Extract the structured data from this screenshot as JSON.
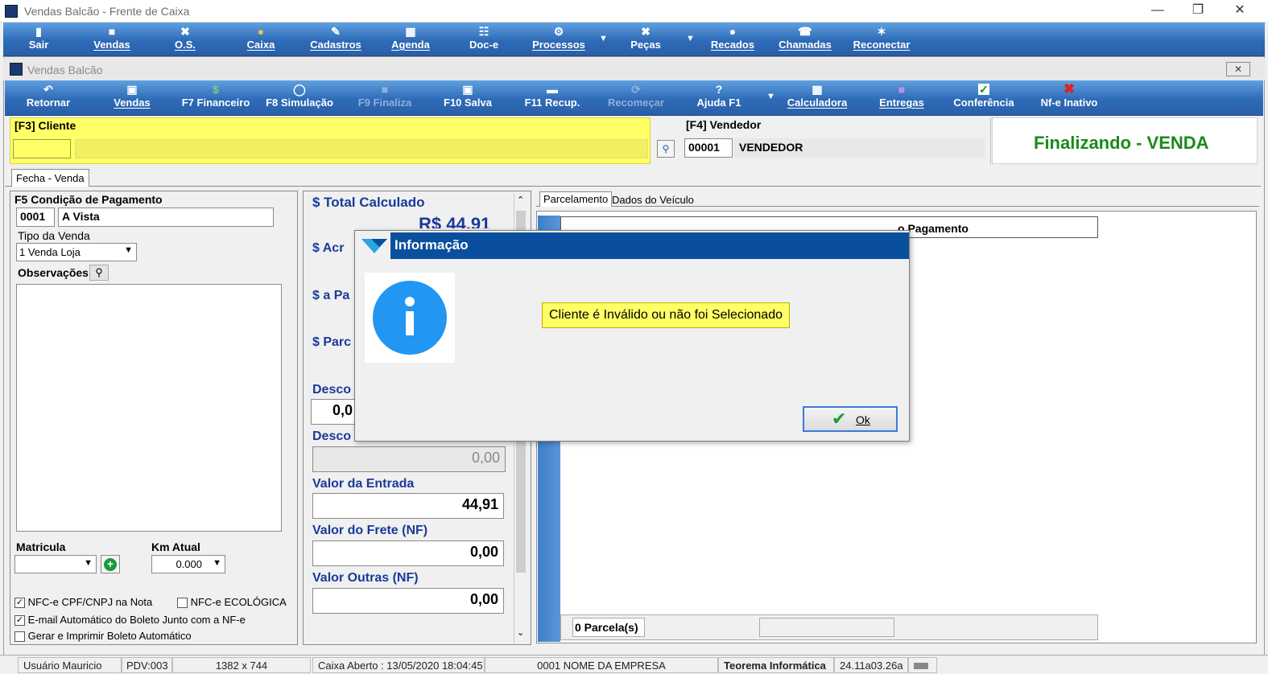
{
  "window": {
    "title": "Vendas Balcão - Frente de Caixa"
  },
  "main_toolbar": [
    {
      "label": "Sair",
      "icon": "exit-icon"
    },
    {
      "label": "Vendas",
      "icon": "sales-icon"
    },
    {
      "label": "O.S.",
      "icon": "tools-icon"
    },
    {
      "label": "Caixa",
      "icon": "cash-icon"
    },
    {
      "label": "Cadastros",
      "icon": "register-icon"
    },
    {
      "label": "Agenda",
      "icon": "calendar-icon"
    },
    {
      "label": "Doc-e",
      "icon": "document-icon"
    },
    {
      "label": "Processos",
      "icon": "gear-icon"
    },
    {
      "label": "Peças",
      "icon": "wrench-icon"
    },
    {
      "label": "Recados",
      "icon": "chat-icon"
    },
    {
      "label": "Chamadas",
      "icon": "support-icon"
    },
    {
      "label": "Reconectar",
      "icon": "reconnect-icon"
    }
  ],
  "inner_window": {
    "title": "Vendas Balcão"
  },
  "sub_toolbar": [
    {
      "label": "Retornar",
      "icon": "return-icon"
    },
    {
      "label": "Vendas",
      "icon": "sales-icon"
    },
    {
      "label": "F7 Financeiro",
      "icon": "money-icon"
    },
    {
      "label": "F8 Simulação",
      "icon": "simulation-icon"
    },
    {
      "label": "F9 Finaliza",
      "icon": "finish-icon"
    },
    {
      "label": "F10 Salva",
      "icon": "save-icon"
    },
    {
      "label": "F11 Recup.",
      "icon": "recover-icon"
    },
    {
      "label": "Recomeçar",
      "icon": "restart-icon"
    },
    {
      "label": "Ajuda F1",
      "icon": "help-icon"
    },
    {
      "label": "Calculadora",
      "icon": "calculator-icon"
    },
    {
      "label": "Entregas",
      "icon": "truck-icon"
    },
    {
      "label": "Conferência",
      "icon": "check-icon"
    },
    {
      "label": "Nf-e Inativo",
      "icon": "close-icon"
    }
  ],
  "client": {
    "label": "[F3] Cliente",
    "code": "",
    "name": ""
  },
  "vendor": {
    "label": "[F4] Vendedor",
    "code": "00001",
    "name": "VENDEDOR"
  },
  "status_title": "Finalizando - VENDA",
  "tabs": {
    "main": "Fecha - Venda",
    "right": [
      "Parcelamento",
      "Dados do Veículo"
    ]
  },
  "payment": {
    "label": "F5 Condição de Pagamento",
    "code": "0001",
    "name": "A Vista",
    "sale_type_label": "Tipo da Venda",
    "sale_type_value": "1 Venda Loja",
    "obs_label": "Observações",
    "matricula_label": "Matricula",
    "km_label": "Km Atual",
    "km_value": "0.000"
  },
  "checkboxes": [
    {
      "label": "NFC-e CPF/CNPJ na Nota",
      "checked": true
    },
    {
      "label": "NFC-e ECOLÓGICA",
      "checked": false
    },
    {
      "label": "E-mail Automático do Boleto Junto com a NF-e",
      "checked": true
    },
    {
      "label": "Gerar e Imprimir Boleto Automático",
      "checked": false
    }
  ],
  "totals": {
    "total_label": "$ Total Calculado",
    "total_value": "R$ 44,91",
    "acr_label": "$ Acr",
    "pagar_label": "$ a Pa",
    "parc_label": "$ Parc",
    "desc1_label": "Desco",
    "desc1_value": "0,0",
    "desc2_label": "Desco",
    "desc2_value": "0,00",
    "entrada_label": "Valor da Entrada",
    "entrada_value": "44,91",
    "frete_label": "Valor do Frete (NF)",
    "frete_value": "0,00",
    "outras_label": "Valor Outras (NF)",
    "outras_value": "0,00"
  },
  "installments": {
    "header_last": "o Pagamento",
    "count_label": "0 Parcela(s)"
  },
  "dialog": {
    "title": "Informação",
    "message": "Cliente é Inválido ou não foi Selecionado",
    "ok_label": "Ok"
  },
  "statusbar": {
    "user": "Usuário Mauricio",
    "pdv": "PDV:003",
    "resolution": "1382 x 744",
    "cash": "Caixa Aberto : 13/05/2020 18:04:45",
    "company": "0001 NOME DA EMPRESA",
    "brand": "Teorema Informática",
    "version": "24.11a03.26a"
  },
  "colors": {
    "toolbar": "#2e6bb8",
    "client_bg": "#ffff66",
    "status_green": "#1a8a1a",
    "label_blue": "#1a3a9a",
    "dialog_title": "#0a4f9e",
    "info_icon": "#2196f3"
  }
}
